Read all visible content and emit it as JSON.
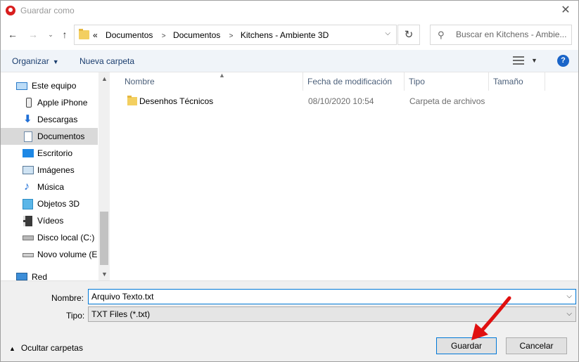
{
  "window": {
    "title": "Guardar como",
    "colors": {
      "app_icon": "#d81e1e",
      "accent": "#0078d7",
      "help": "#1a64c8",
      "annotation": "#e01010"
    }
  },
  "address": {
    "prefix": "«",
    "crumbs": [
      "Documentos",
      "Documentos",
      "Kitchens - Ambiente 3D"
    ]
  },
  "search": {
    "placeholder": "Buscar en Kitchens - Ambie..."
  },
  "toolbar": {
    "organize_label": "Organizar",
    "new_folder_label": "Nueva carpeta",
    "help_label": "?"
  },
  "sidebar": {
    "items": [
      {
        "label": "Este equipo",
        "icon": "computer-icon"
      },
      {
        "label": "Apple iPhone",
        "icon": "phone-icon"
      },
      {
        "label": "Descargas",
        "icon": "downloads-icon"
      },
      {
        "label": "Documentos",
        "icon": "documents-icon",
        "selected": true
      },
      {
        "label": "Escritorio",
        "icon": "desktop-icon"
      },
      {
        "label": "Imágenes",
        "icon": "pictures-icon"
      },
      {
        "label": "Música",
        "icon": "music-icon"
      },
      {
        "label": "Objetos 3D",
        "icon": "objects-3d-icon"
      },
      {
        "label": "Vídeos",
        "icon": "videos-icon"
      },
      {
        "label": "Disco local (C:)",
        "icon": "local-disk-icon"
      },
      {
        "label": "Novo volume (E:",
        "icon": "drive-icon"
      },
      {
        "label": "Red",
        "icon": "network-icon"
      }
    ]
  },
  "columns": [
    "Nombre",
    "Fecha de modificación",
    "Tipo",
    "Tamaño"
  ],
  "files": [
    {
      "name": "Desenhos Técnicos",
      "date": "08/10/2020 10:54",
      "type": "Carpeta de archivos"
    }
  ],
  "form": {
    "name_label": "Nombre:",
    "name_value": "Arquivo Texto.txt",
    "type_label": "Tipo:",
    "type_value": "TXT Files (*.txt)"
  },
  "footer": {
    "hide_folders_label": "Ocultar carpetas",
    "save_label": "Guardar",
    "cancel_label": "Cancelar"
  }
}
